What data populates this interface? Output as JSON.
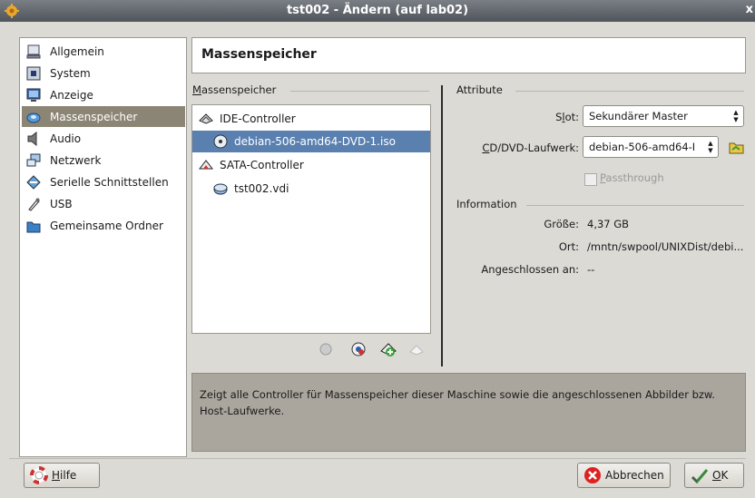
{
  "window": {
    "title": "tst002 - Ändern (auf lab02)",
    "close_glyph": "x"
  },
  "sidebar": {
    "items": [
      {
        "label": "Allgemein",
        "icon": "general-icon"
      },
      {
        "label": "System",
        "icon": "system-icon"
      },
      {
        "label": "Anzeige",
        "icon": "display-icon"
      },
      {
        "label": "Massenspeicher",
        "icon": "storage-icon",
        "selected": true
      },
      {
        "label": "Audio",
        "icon": "audio-icon"
      },
      {
        "label": "Netzwerk",
        "icon": "network-icon"
      },
      {
        "label": "Serielle Schnittstellen",
        "icon": "serial-icon"
      },
      {
        "label": "USB",
        "icon": "usb-icon"
      },
      {
        "label": "Gemeinsame Ordner",
        "icon": "shared-folder-icon"
      }
    ]
  },
  "header": {
    "title": "Massenspeicher"
  },
  "storage": {
    "group_label": "Massenspeicher",
    "tree": [
      {
        "label": "IDE-Controller",
        "type": "controller"
      },
      {
        "label": "debian-506-amd64-DVD-1.iso",
        "type": "dvd",
        "selected": true
      },
      {
        "label": "SATA-Controller",
        "type": "controller"
      },
      {
        "label": "tst002.vdi",
        "type": "disk"
      }
    ]
  },
  "attributes": {
    "group_label": "Attribute",
    "slot_label_pre": "S",
    "slot_label_u": "l",
    "slot_label_post": "ot:",
    "slot_value": "Sekundärer Master",
    "cd_label_u": "C",
    "cd_label_rest": "D/DVD-Laufwerk:",
    "cd_value": "debian-506-amd64-I",
    "passthrough_u": "P",
    "passthrough_rest": "assthrough",
    "passthrough_checked": false
  },
  "information": {
    "group_label": "Information",
    "size_label": "Größe:",
    "size_value": "4,37 GB",
    "location_label": "Ort:",
    "location_value": "/mntn/swpool/UNIXDist/debi...",
    "attached_label": "Angeschlossen an:",
    "attached_value": "--"
  },
  "description": "Zeigt alle Controller für Massenspeicher dieser Maschine sowie die angeschlossenen Abbilder bzw. Host-Laufwerke.",
  "buttons": {
    "help_u": "H",
    "help_rest": "ilfe",
    "cancel": "Abbrechen",
    "ok_u": "O",
    "ok_rest": "K"
  }
}
